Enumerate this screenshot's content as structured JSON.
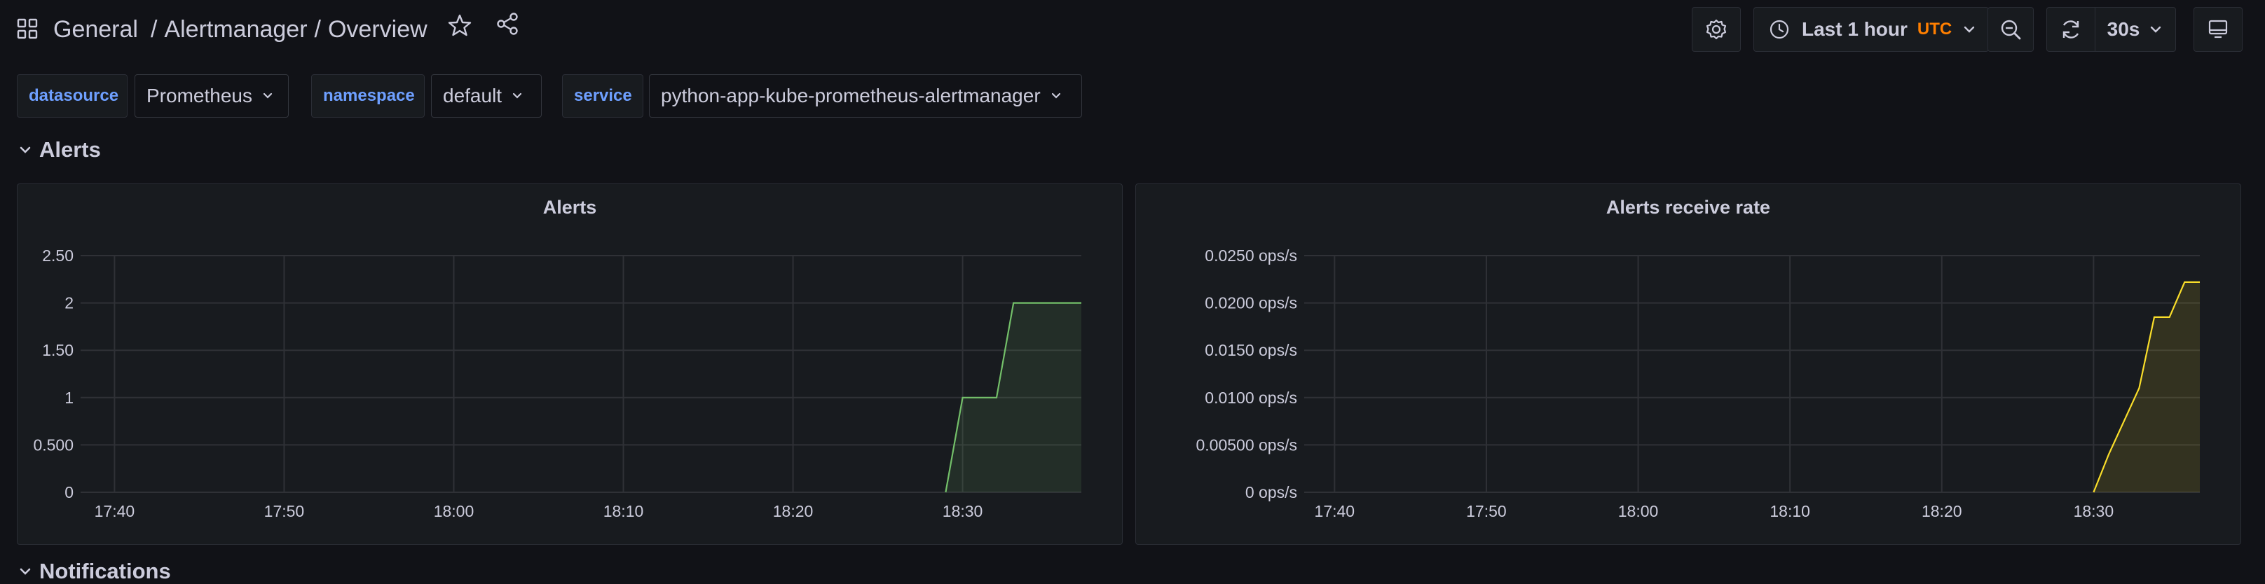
{
  "breadcrumb": {
    "folder": "General",
    "separator1": "/",
    "dashboard_parent": "Alertmanager",
    "separator2": "/",
    "dashboard": "Overview"
  },
  "toolbar": {
    "time_range": "Last 1 hour",
    "timezone": "UTC",
    "refresh_interval": "30s"
  },
  "icons": [
    "apps-icon",
    "star-icon",
    "share-icon",
    "settings-gear-icon",
    "clock-icon",
    "chevron-down-icon",
    "zoom-out-icon",
    "refresh-icon",
    "tv-mode-icon"
  ],
  "variables": [
    {
      "label": "datasource",
      "value": "Prometheus"
    },
    {
      "label": "namespace",
      "value": "default"
    },
    {
      "label": "service",
      "value": "python-app-kube-prometheus-alertmanager"
    }
  ],
  "rows": [
    {
      "title": "Alerts"
    },
    {
      "title": "Notifications"
    }
  ],
  "colors": {
    "background": "#111217",
    "panel": "#181b1f",
    "series_green": "#73bf69",
    "series_yellow": "#fade2a",
    "accent_blue": "#6e9fff",
    "utc_orange": "#ff7f00"
  },
  "chart_data": [
    {
      "type": "area",
      "title": "Alerts",
      "x_tick_labels": [
        "17:40",
        "17:50",
        "18:00",
        "18:10",
        "18:20",
        "18:30"
      ],
      "y_tick_labels": [
        "0",
        "0.500",
        "1",
        "1.50",
        "2",
        "2.50"
      ],
      "ylim": [
        0,
        2.5
      ],
      "xlim": [
        "17:38",
        "18:37"
      ],
      "grid": true,
      "series": [
        {
          "color": "#73bf69",
          "x": [
            "18:29",
            "18:30",
            "18:32",
            "18:33",
            "18:37"
          ],
          "y": [
            0,
            1,
            1,
            2,
            2
          ]
        }
      ]
    },
    {
      "type": "area",
      "title": "Alerts receive rate",
      "x_tick_labels": [
        "17:40",
        "17:50",
        "18:00",
        "18:10",
        "18:20",
        "18:30"
      ],
      "y_tick_labels": [
        "0 ops/s",
        "0.00500 ops/s",
        "0.0100 ops/s",
        "0.0150 ops/s",
        "0.0200 ops/s",
        "0.0250 ops/s"
      ],
      "ylim": [
        0,
        0.025
      ],
      "xlim": [
        "17:38",
        "18:37"
      ],
      "grid": true,
      "series": [
        {
          "color": "#fade2a",
          "x": [
            "18:30",
            "18:31",
            "18:33",
            "18:34",
            "18:35",
            "18:36",
            "18:37"
          ],
          "y": [
            0,
            0.004,
            0.011,
            0.0185,
            0.0185,
            0.0222,
            0.0222
          ]
        }
      ]
    }
  ]
}
